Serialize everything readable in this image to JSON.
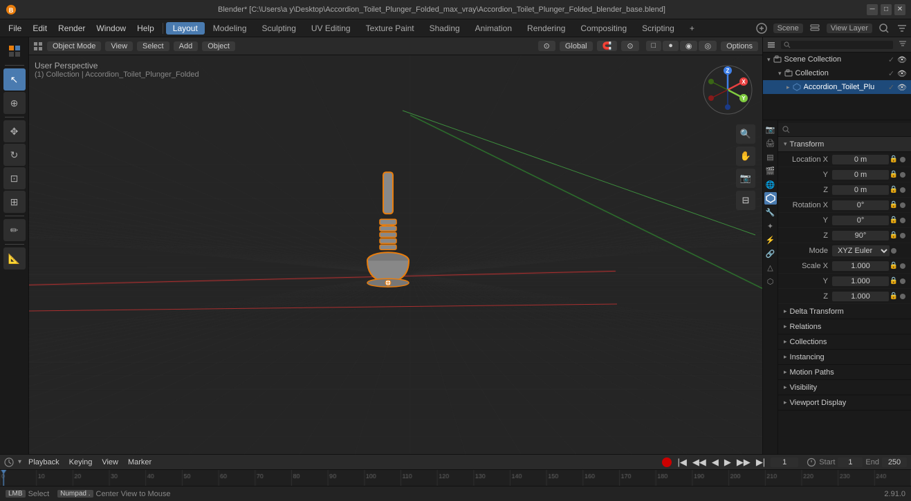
{
  "titlebar": {
    "title": "Blender* [C:\\Users\\a y\\Desktop\\Accordion_Toilet_Plunger_Folded_max_vray\\Accordion_Toilet_Plunger_Folded_blender_base.blend]",
    "logo": "Blender*"
  },
  "menubar": {
    "items": [
      "File",
      "Edit",
      "Render",
      "Window",
      "Help"
    ],
    "workspaces": [
      "Layout",
      "Modeling",
      "Sculpting",
      "UV Editing",
      "Texture Paint",
      "Shading",
      "Animation",
      "Rendering",
      "Compositing",
      "Scripting"
    ],
    "active_workspace": "Layout",
    "scene": "Scene",
    "view_layer": "View Layer",
    "add_workspace": "+"
  },
  "viewport_header": {
    "mode": "Object Mode",
    "view": "View",
    "select": "Select",
    "add": "Add",
    "object": "Object",
    "transform": "Global",
    "options": "Options"
  },
  "viewport": {
    "perspective": "User Perspective",
    "collection_info": "(1) Collection | Accordion_Toilet_Plunger_Folded"
  },
  "left_tools": [
    {
      "icon": "↖",
      "name": "select-tool",
      "active": true
    },
    {
      "icon": "⊕",
      "name": "cursor-tool",
      "active": false
    },
    {
      "icon": "✥",
      "name": "move-tool",
      "active": false
    },
    {
      "icon": "↻",
      "name": "rotate-tool",
      "active": false
    },
    {
      "icon": "⊡",
      "name": "scale-tool",
      "active": false
    },
    {
      "icon": "⊞",
      "name": "transform-tool",
      "active": false
    },
    {
      "icon": "✏",
      "name": "annotate-tool",
      "active": false
    },
    {
      "icon": "📐",
      "name": "measure-tool",
      "active": false
    }
  ],
  "outliner": {
    "title": "Scene Collection",
    "search_placeholder": "",
    "items": [
      {
        "label": "Scene Collection",
        "type": "collection",
        "depth": 0,
        "expanded": true,
        "visible": true,
        "checked": true
      },
      {
        "label": "Collection",
        "type": "collection",
        "depth": 1,
        "expanded": true,
        "visible": true,
        "checked": true
      },
      {
        "label": "Accordion_Toilet_Plu",
        "type": "mesh",
        "depth": 2,
        "expanded": false,
        "visible": true,
        "checked": true,
        "selected": true
      }
    ]
  },
  "properties": {
    "search_placeholder": "",
    "tabs": [
      "render",
      "output",
      "view-layer",
      "scene",
      "world",
      "object",
      "modifier",
      "particles",
      "physics",
      "constraints",
      "object-data",
      "material",
      "shader"
    ],
    "active_tab": "object",
    "transform": {
      "title": "Transform",
      "location": {
        "x": "0 m",
        "y": "0 m",
        "z": "0 m"
      },
      "rotation": {
        "x": "0°",
        "y": "0°",
        "z": "90°"
      },
      "mode": "XYZ Euler",
      "scale": {
        "x": "1.000",
        "y": "1.000",
        "z": "1.000"
      }
    },
    "delta_transform": {
      "title": "Delta Transform",
      "collapsed": true
    },
    "relations": {
      "title": "Relations",
      "collapsed": true
    },
    "collections": {
      "title": "Collections",
      "collapsed": true
    },
    "instancing": {
      "title": "Instancing",
      "collapsed": true
    },
    "motion_paths": {
      "title": "Motion Paths",
      "collapsed": true
    },
    "visibility": {
      "title": "Visibility",
      "collapsed": true
    },
    "viewport_display": {
      "title": "Viewport Display",
      "collapsed": true
    }
  },
  "timeline": {
    "playback_label": "Playback",
    "keying_label": "Keying",
    "view_label": "View",
    "marker_label": "Marker",
    "current_frame": "1",
    "start_frame": "1",
    "end_frame": "250",
    "start_label": "Start",
    "end_label": "End"
  },
  "statusbar": {
    "select_key": "Select",
    "center_key": "Center View to Mouse",
    "version": "2.91.0"
  },
  "gizmo": {
    "x_color": "#e84040",
    "y_color": "#80cc40",
    "z_color": "#4080e8",
    "x_label": "X",
    "y_label": "Y",
    "z_label": "Z"
  }
}
